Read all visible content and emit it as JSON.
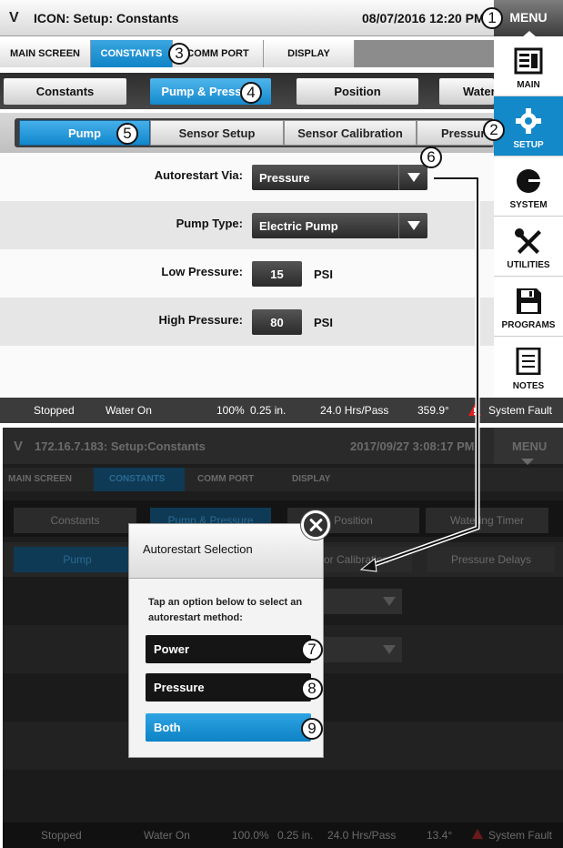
{
  "top": {
    "logo": "V",
    "title": "ICON: Setup: Constants",
    "datetime": "08/07/2016 12:20 PM",
    "menu_label": "MENU",
    "tabs1": [
      "MAIN SCREEN",
      "CONSTANTS",
      "COMM PORT",
      "DISPLAY"
    ],
    "tabs2": [
      "Constants",
      "Pump & Pressure",
      "Position",
      "Watering Timer"
    ],
    "tabs3": [
      "Pump",
      "Sensor Setup",
      "Sensor Calibration",
      "Pressure Delays"
    ],
    "fields": {
      "autorestart": {
        "label": "Autorestart Via:",
        "value": "Pressure"
      },
      "pump_type": {
        "label": "Pump Type:",
        "value": "Electric Pump"
      },
      "low_pressure": {
        "label": "Low Pressure:",
        "value": "15",
        "unit": "PSI"
      },
      "high_pressure": {
        "label": "High Pressure:",
        "value": "80",
        "unit": "PSI"
      }
    },
    "status": {
      "state": "Stopped",
      "water": "Water On",
      "speed": "100%",
      "depth": "0.25 in.",
      "hrs": "24.0 Hrs/Pass",
      "angle": "359.9°",
      "fault": "System Fault"
    },
    "sidebar": [
      "MAIN",
      "SETUP",
      "SYSTEM",
      "UTILITIES",
      "PROGRAMS",
      "NOTES"
    ]
  },
  "bottom": {
    "logo": "V",
    "title": "172.16.7.183: Setup:Constants",
    "datetime": "2017/09/27 3:08:17 PM",
    "menu_label": "MENU",
    "tabs1": [
      "MAIN SCREEN",
      "CONSTANTS",
      "COMM PORT",
      "DISPLAY"
    ],
    "tabs2": [
      "Constants",
      "Pump & Pressure",
      "Position",
      "Watering Timer"
    ],
    "tabs3": [
      "Pump",
      "Sensor Calibration",
      "Pressure Delays"
    ],
    "status": {
      "state": "Stopped",
      "water": "Water On",
      "speed": "100.0%",
      "depth": "0.25 in.",
      "hrs": "24.0 Hrs/Pass",
      "angle": "13.4°",
      "fault": "System Fault"
    },
    "dialog": {
      "title": "Autorestart Selection",
      "message": "Tap an option below to select an autorestart method:",
      "options": [
        "Power",
        "Pressure",
        "Both"
      ]
    }
  },
  "callouts": [
    "1",
    "2",
    "3",
    "4",
    "5",
    "6",
    "7",
    "8",
    "9"
  ],
  "colors": {
    "accent": "#1389c9",
    "fault": "#e02020"
  }
}
